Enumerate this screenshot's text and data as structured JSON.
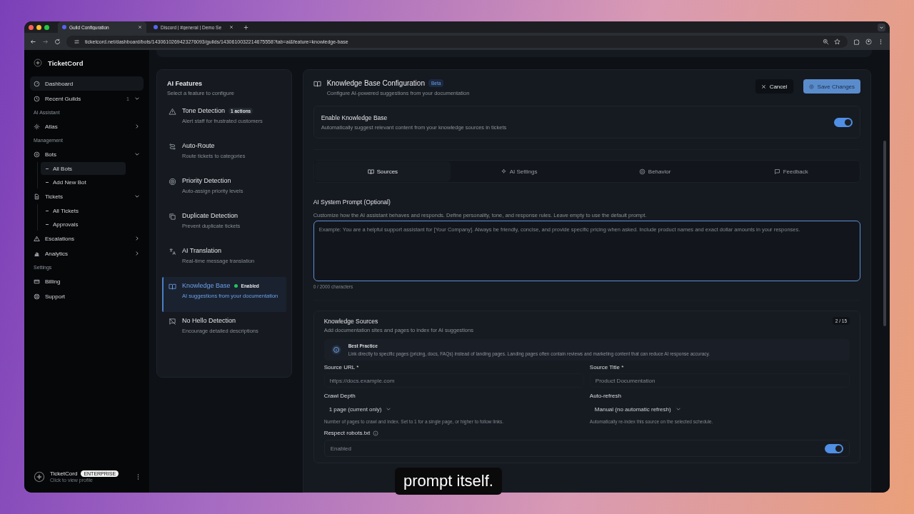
{
  "browser": {
    "tabs": [
      {
        "title": "Guild Configuration",
        "selected": true
      },
      {
        "title": "Discord | #general | Demo Se",
        "selected": false
      }
    ],
    "url": "ticketcord.net/dashboard/bots/1430610269423276093/guilds/1430610032214675558?tab=ai&feature=knowledge-base"
  },
  "sidebar": {
    "brand": "TicketCord",
    "sections": [
      {
        "items": [
          {
            "label": "Dashboard",
            "selected": true
          },
          {
            "label": "Recent Guilds",
            "count": "1",
            "expanded": true,
            "selected": false
          }
        ]
      },
      {
        "heading": "AI Assistant",
        "items": [
          {
            "label": "Atlas",
            "expanded": false,
            "selected": false
          }
        ]
      },
      {
        "heading": "Management",
        "items": [
          {
            "label": "Bots",
            "expanded": true,
            "selected": false,
            "children": [
              {
                "label": "All Bots",
                "selected": true
              },
              {
                "label": "Add New Bot",
                "selected": false
              }
            ]
          },
          {
            "label": "Tickets",
            "expanded": true,
            "selected": false,
            "children": [
              {
                "label": "All Tickets",
                "selected": false
              },
              {
                "label": "Approvals",
                "selected": false
              }
            ]
          },
          {
            "label": "Escalations",
            "expanded": false,
            "selected": false
          },
          {
            "label": "Analytics",
            "expanded": false,
            "selected": false
          }
        ]
      },
      {
        "heading": "Settings",
        "items": [
          {
            "label": "Billing",
            "selected": false
          },
          {
            "label": "Support",
            "selected": false
          }
        ]
      }
    ],
    "profile": {
      "name": "TicketCord",
      "plan": "ENTERPRISE",
      "hint": "Click to view profile"
    }
  },
  "features": {
    "title": "AI Features",
    "subtitle": "Select a feature to configure",
    "items": [
      {
        "title": "Tone Detection",
        "badge": "1 actions",
        "description": "Alert staff for frustrated customers",
        "selected": false
      },
      {
        "title": "Auto-Route",
        "description": "Route tickets to categories",
        "selected": false
      },
      {
        "title": "Priority Detection",
        "description": "Auto-assign priority levels",
        "selected": false
      },
      {
        "title": "Duplicate Detection",
        "description": "Prevent duplicate tickets",
        "selected": false
      },
      {
        "title": "AI Translation",
        "description": "Real-time message translation",
        "selected": false
      },
      {
        "title": "Knowledge Base",
        "status": "Enabled",
        "color": "#22c55e",
        "description": "AI suggestions from your documentation",
        "selected": true
      },
      {
        "title": "No Hello Detection",
        "description": "Encourage detailed descriptions",
        "selected": false
      }
    ]
  },
  "config": {
    "title": "Knowledge Base Configuration",
    "badge": "Beta",
    "subtitle": "Configure AI-powered suggestions from your documentation",
    "cancel": "Cancel",
    "save": "Save Changes",
    "enable": {
      "label": "Enable Knowledge Base",
      "description": "Automatically suggest relevant content from your knowledge sources in tickets",
      "on": true
    },
    "tabs": [
      {
        "label": "Sources",
        "selected": true
      },
      {
        "label": "AI Settings",
        "selected": false
      },
      {
        "label": "Behavior",
        "selected": false
      },
      {
        "label": "Feedback",
        "selected": false
      }
    ],
    "prompt": {
      "label": "AI System Prompt (Optional)",
      "help": "Customize how the AI assistant behaves and responds. Define personality, tone, and response rules. Leave empty to use the default prompt.",
      "placeholder": "Example: You are a helpful support assistant for [Your Company]. Always be friendly, concise, and provide specific pricing when asked. Include product names and exact dollar amounts in your responses.",
      "counter": "0 / 2000 characters"
    },
    "sources": {
      "title": "Knowledge Sources",
      "description": "Add documentation sites and pages to index for AI suggestions",
      "count": "2 / 15",
      "tip_title": "Best Practice",
      "tip": "Link directly to specific pages (pricing, docs, FAQs) instead of landing pages. Landing pages often contain reviews and marketing content that can reduce AI response accuracy.",
      "url_label": "Source URL *",
      "url_placeholder": "https://docs.example.com",
      "title_label": "Source Title *",
      "title_placeholder": "Product Documentation",
      "depth_label": "Crawl Depth",
      "depth_value": "1 page (current only)",
      "depth_help": "Number of pages to crawl and index. Set to 1 for a single page, or higher to follow links.",
      "refresh_label": "Auto-refresh",
      "refresh_value": "Manual (no automatic refresh)",
      "refresh_help": "Automatically re-index this source on the selected schedule.",
      "robots_label": "Respect robots.txt",
      "robots_state": "Enabled",
      "robots_on": true
    }
  },
  "caption": "prompt itself."
}
